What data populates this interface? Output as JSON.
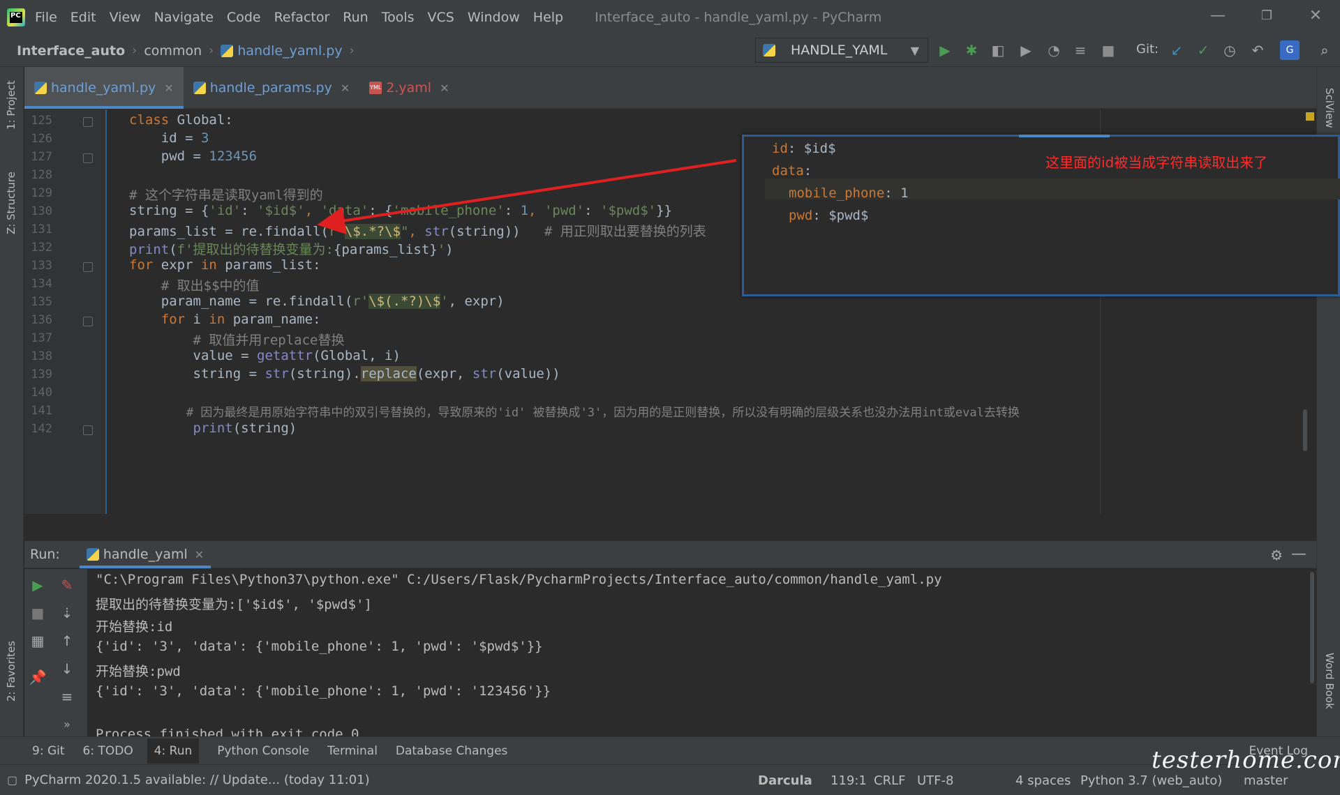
{
  "menu": {
    "items": [
      "File",
      "Edit",
      "View",
      "Navigate",
      "Code",
      "Refactor",
      "Run",
      "Tools",
      "VCS",
      "Window",
      "Help"
    ],
    "window_title": "Interface_auto - handle_yaml.py - PyCharm"
  },
  "breadcrumb": {
    "project": "Interface_auto",
    "folder": "common",
    "file": "handle_yaml.py"
  },
  "run_config": {
    "label": "HANDLE_YAML"
  },
  "git": {
    "label": "Git:"
  },
  "sidebars": {
    "left": [
      "1: Project",
      "Z: Structure",
      "2: Favorites"
    ],
    "right": [
      "SciView",
      "Word Book"
    ]
  },
  "editor_tabs": [
    {
      "label": "handle_yaml.py",
      "active": true
    },
    {
      "label": "handle_params.py",
      "active": false
    },
    {
      "label": "2.yaml",
      "active": false
    }
  ],
  "editor": {
    "line_numbers": [
      "125",
      "126",
      "127",
      "128",
      "129",
      "130",
      "131",
      "132",
      "133",
      "134",
      "135",
      "136",
      "137",
      "138",
      "139",
      "140",
      "141",
      "142"
    ],
    "lines": {
      "l125": {
        "a": "class",
        "b": " Global:"
      },
      "l126": {
        "a": "    id = ",
        "b": "3"
      },
      "l127": {
        "a": "    pwd = ",
        "b": "123456"
      },
      "l129": "# 这个字符串是读取yaml得到的",
      "l130": {
        "a": "string = {",
        "b": "'id'",
        "c": ": ",
        "d": "'$id$'",
        "e": ", ",
        "f": "'data'",
        "g": ": {",
        "h": "'mobile_phone'",
        "i": ": ",
        "j": "1",
        "k": ", ",
        "l": "'pwd'",
        "m": ": ",
        "n": "'$pwd$'",
        "o": "}}"
      },
      "l131": {
        "a": "params_list = re.findall(",
        "b": "r\"",
        "c": "\\$.*?\\$",
        "d": "\"",
        "e": ", ",
        "f": "str",
        "g": "(string))   ",
        "h": "# 用正则取出要替换的列表"
      },
      "l132": {
        "a": "print",
        "b": "(",
        "c": "f'提取出的待替换变量为:",
        "d": "{params_list}",
        "e": "'",
        "f": ")"
      },
      "l133": {
        "a": "for",
        "b": " expr ",
        "c": "in",
        "d": " params_list:"
      },
      "l134": "    # 取出$$中的值",
      "l135": {
        "a": "    param_name = re.findall(",
        "b": "r'",
        "c": "\\$(.*?)\\$",
        "d": "'",
        "e": ", expr)"
      },
      "l136": {
        "a": "    for",
        "b": " i ",
        "c": "in",
        "d": " param_name:"
      },
      "l137": "        # 取值并用replace替换",
      "l138": {
        "a": "        value = ",
        "b": "getattr",
        "c": "(Global, i)"
      },
      "l139": {
        "a": "        string = ",
        "b": "str",
        "c": "(string).",
        "d": "replace",
        "e": "(expr, ",
        "f": "str",
        "g": "(value))"
      },
      "l141": "        # 因为最终是用原始字符串中的双引号替换的，导致原来的'id' 被替换成'3'，因为用的是正则替换，所以没有明确的层级关系也没办法用int或eval去转换",
      "l142": {
        "a": "        ",
        "b": "print",
        "c": "(string)"
      }
    }
  },
  "yaml_popup": {
    "l1": {
      "key": "id",
      "val": ": $id$"
    },
    "l2": {
      "key": "data",
      "val": ":"
    },
    "l3": {
      "key": "mobile_phone",
      "val": ": 1"
    },
    "l4": {
      "key": "pwd",
      "val": ": $pwd$"
    },
    "annotation": "这里面的id被当成字符串读取出来了"
  },
  "run_panel": {
    "title": "Run:",
    "tab": "handle_yaml",
    "output": [
      "\"C:\\Program Files\\Python37\\python.exe\" C:/Users/Flask/PycharmProjects/Interface_auto/common/handle_yaml.py",
      "提取出的待替换变量为:['$id$', '$pwd$']",
      "开始替换:id",
      "{'id': '3', 'data': {'mobile_phone': 1, 'pwd': '$pwd$'}}",
      "开始替换:pwd",
      "{'id': '3', 'data': {'mobile_phone': 1, 'pwd': '123456'}}",
      "",
      "Process finished with exit code 0"
    ]
  },
  "tool_windows": {
    "git": "9: Git",
    "todo": "6: TODO",
    "run": "4: Run",
    "python_console": "Python Console",
    "terminal": "Terminal",
    "db_changes": "Database Changes",
    "event_log": "Event Log"
  },
  "status": {
    "message": "PyCharm 2020.1.5 available: // Update... (today 11:01)",
    "theme": "Darcula",
    "position": "119:1",
    "line_sep": "CRLF",
    "encoding": "UTF-8",
    "indent": "4 spaces",
    "interpreter": "Python 3.7 (web_auto)",
    "branch": "master"
  },
  "watermark": "testerhome.com",
  "colors": {
    "accent": "#4a88c7",
    "annotation": "#ff2a2a",
    "run_green": "#499c54"
  }
}
